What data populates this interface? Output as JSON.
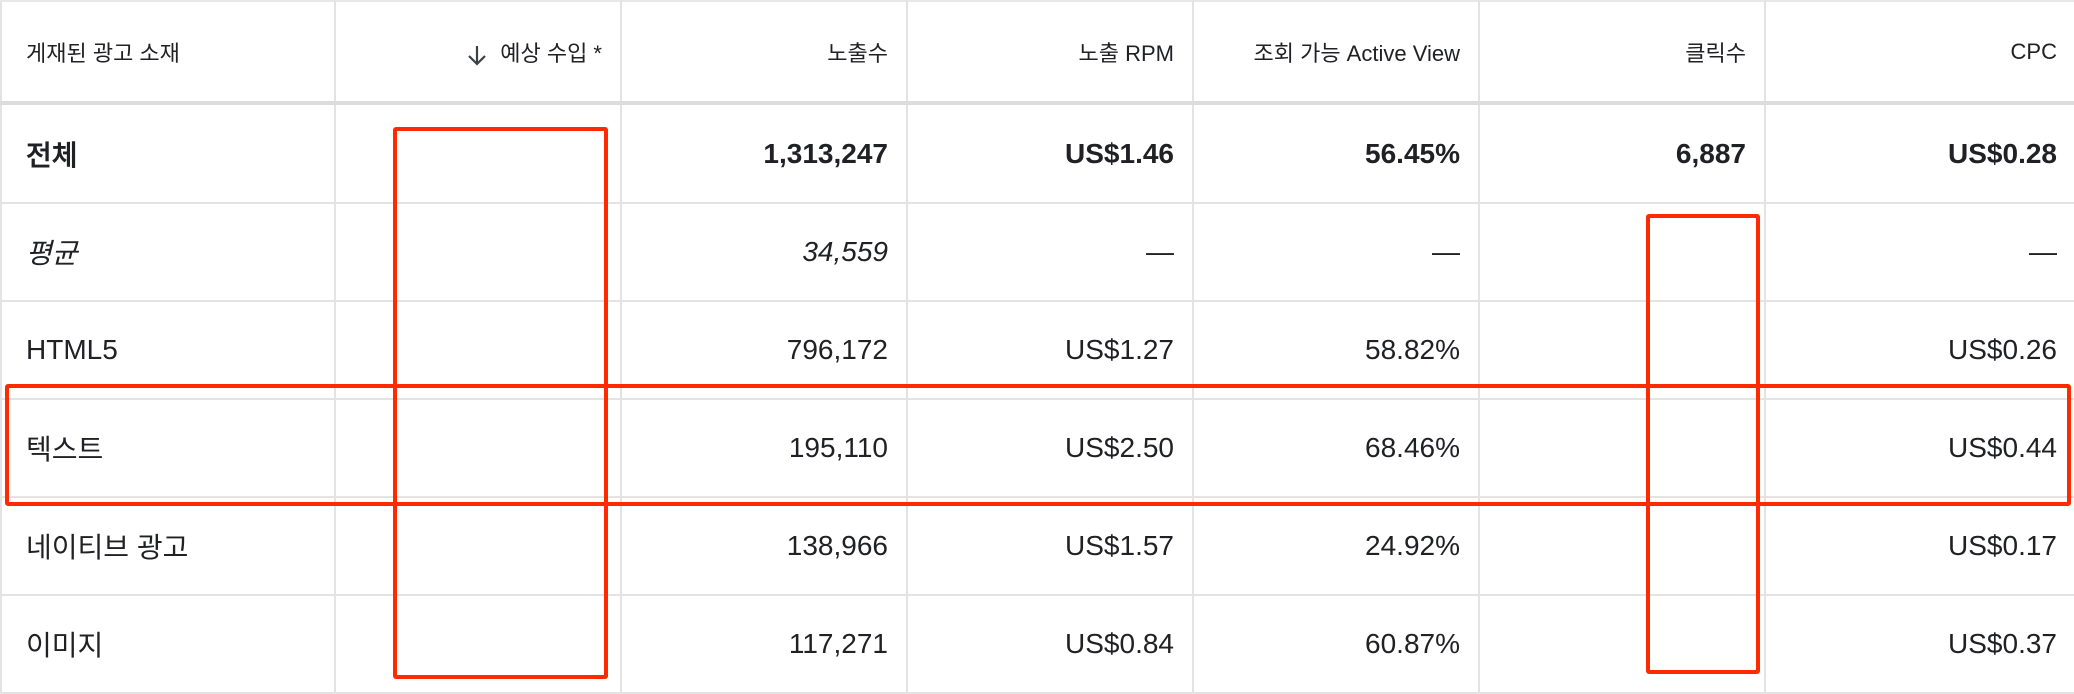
{
  "header": {
    "creative": "게재된 광고 소재",
    "revenue": "예상 수입 *",
    "impressions": "노출수",
    "rpm": "노출 RPM",
    "active_view": "조회 가능 Active View",
    "clicks": "클릭수",
    "cpc": "CPC"
  },
  "rows": {
    "total": {
      "label": "전체",
      "impressions": "1,313,247",
      "rpm": "US$1.46",
      "active_view": "56.45%",
      "clicks": "6,887",
      "cpc": "US$0.28"
    },
    "average": {
      "label": "평균",
      "impressions": "34,559",
      "rpm": "—",
      "active_view": "—",
      "cpc": "—"
    },
    "html5": {
      "label": "HTML5",
      "impressions": "796,172",
      "rpm": "US$1.27",
      "active_view": "58.82%",
      "cpc": "US$0.26"
    },
    "text": {
      "label": "텍스트",
      "impressions": "195,110",
      "rpm": "US$2.50",
      "active_view": "68.46%",
      "cpc": "US$0.44"
    },
    "native": {
      "label": "네이티브 광고",
      "impressions": "138,966",
      "rpm": "US$1.57",
      "active_view": "24.92%",
      "cpc": "US$0.17"
    },
    "image": {
      "label": "이미지",
      "impressions": "117,271",
      "rpm": "US$0.84",
      "active_view": "60.87%",
      "cpc": "US$0.37"
    }
  },
  "icons": {
    "sort": "arrow-down-icon"
  },
  "colors": {
    "annotation": "#ff2a00",
    "grid": "#e3e3e3",
    "text": "#202124"
  }
}
